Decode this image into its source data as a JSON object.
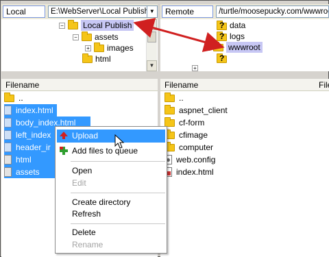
{
  "local": {
    "site_label": "Local site:",
    "path": "E:\\WebServer\\Local Publish\\",
    "tree": [
      {
        "label": "Local Publish",
        "expander": "−",
        "highlighted": true
      },
      {
        "label": "assets",
        "expander": "−"
      },
      {
        "label": "images",
        "expander": "+"
      },
      {
        "label": "html"
      }
    ],
    "header": "Filename",
    "files": [
      {
        "name": ".."
      },
      {
        "name": "index.html"
      },
      {
        "name": "body_index.html"
      },
      {
        "name": "left_index"
      },
      {
        "name": "header_ir"
      },
      {
        "name": "html"
      },
      {
        "name": "assets"
      }
    ]
  },
  "remote": {
    "site_label": "Remote site:",
    "path": "/turtle/moosepucky.com/wwwroot",
    "tree": [
      {
        "label": "data"
      },
      {
        "label": "logs"
      },
      {
        "label": "wwwroot",
        "expander": "+",
        "highlighted": true
      }
    ],
    "header": "Filename",
    "header_right": "File",
    "files": [
      {
        "name": ".."
      },
      {
        "name": "aspnet_client"
      },
      {
        "name": "cf-form"
      },
      {
        "name": "cfimage"
      },
      {
        "name": "computer"
      },
      {
        "name": "web.config"
      },
      {
        "name": "index.html"
      }
    ]
  },
  "context_menu": {
    "items": [
      {
        "label": "Upload",
        "icon": "upload-arrow-icon",
        "hot": true
      },
      {
        "label": "Add files to queue",
        "icon": "add-to-queue-icon"
      },
      {
        "label": "Open"
      },
      {
        "label": "Edit",
        "disabled": true
      },
      {
        "label": "Create directory"
      },
      {
        "label": "Refresh"
      },
      {
        "label": "Delete"
      },
      {
        "label": "Rename",
        "disabled": true
      }
    ]
  },
  "colors": {
    "selection": "#3399ff",
    "tree_highlight": "#c7c7f4",
    "arrow": "#d02020"
  }
}
